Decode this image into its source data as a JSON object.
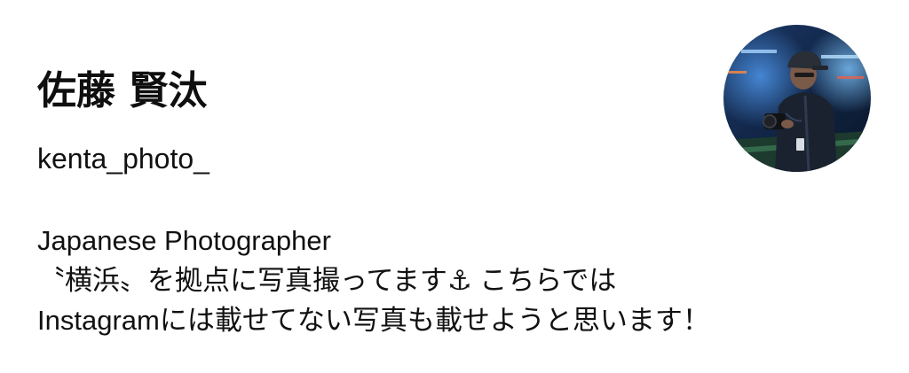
{
  "profile": {
    "display_name": "佐藤 賢汰",
    "username": "kenta_photo_",
    "avatar_icon": "profile-photo-avatar",
    "bio": {
      "line1": "Japanese Photographer",
      "line2": "〝横浜〟を拠点に写真撮ってます⚓ こちらでは",
      "line3": "Instagramには載せてない写真も載せようと思います！"
    }
  },
  "colors": {
    "background": "#ffffff",
    "text": "#111111"
  }
}
